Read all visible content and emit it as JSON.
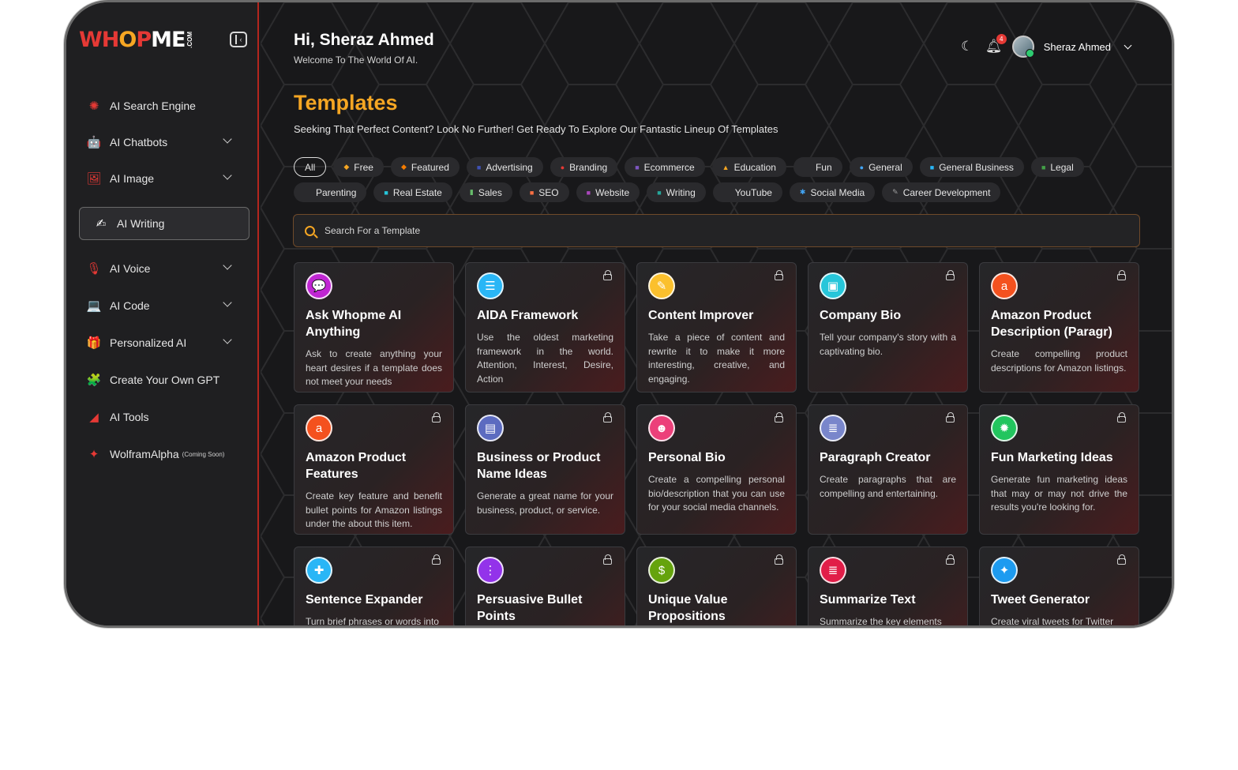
{
  "brand": {
    "logo_w": "WH",
    "logo_o": "O",
    "logo_p": "P",
    "logo_me": "ME",
    "logo_sub": ".COM"
  },
  "sidebar": {
    "items": [
      {
        "label": "AI Search Engine",
        "icon": "✺",
        "color": "#e53935"
      },
      {
        "label": "AI Chatbots",
        "icon": "🤖",
        "color": "#e53935"
      },
      {
        "label": "AI Image",
        "icon": "🖼",
        "color": "#e53935"
      },
      {
        "label": "AI Writing",
        "icon": "✍",
        "color": "#ffffff"
      },
      {
        "label": "AI Voice",
        "icon": "🎙",
        "color": "#e53935"
      },
      {
        "label": "AI Code",
        "icon": "💻",
        "color": "#e53935"
      },
      {
        "label": "Personalized AI",
        "icon": "🎁",
        "color": "#e53935"
      },
      {
        "label": "Create Your Own GPT",
        "icon": "🧩",
        "color": "#e53935"
      },
      {
        "label": "AI Tools",
        "icon": "◢",
        "color": "#e53935"
      },
      {
        "label": "WolframAlpha",
        "suffix": "(Coming Soon)",
        "icon": "✦",
        "color": "#e53935"
      }
    ]
  },
  "header": {
    "greeting": "Hi, Sheraz Ahmed",
    "welcome": "Welcome To The World Of AI.",
    "notif_count": "4",
    "user_name": "Sheraz Ahmed"
  },
  "page": {
    "title": "Templates",
    "subtitle": "Seeking That Perfect Content? Look No Further! Get Ready To Explore Our Fantastic Lineup Of Templates"
  },
  "filters": {
    "row1": [
      {
        "label": "All",
        "icon": "",
        "active": true
      },
      {
        "label": "Free",
        "icon": "◆",
        "color": "#f5a623"
      },
      {
        "label": "Featured",
        "icon": "◆",
        "color": "#f57c00"
      },
      {
        "label": "Advertising",
        "icon": "■",
        "color": "#3f51b5"
      },
      {
        "label": "Branding",
        "icon": "●",
        "color": "#e53935"
      },
      {
        "label": "Ecommerce",
        "icon": "■",
        "color": "#7e57c2"
      },
      {
        "label": "Education",
        "icon": "▲",
        "color": "#f5a623"
      },
      {
        "label": "Fun",
        "icon": "",
        "color": ""
      },
      {
        "label": "General",
        "icon": "●",
        "color": "#42a5f5"
      },
      {
        "label": "General Business",
        "icon": "■",
        "color": "#29b6f6"
      },
      {
        "label": "Legal",
        "icon": "■",
        "color": "#43a047"
      }
    ],
    "row2": [
      {
        "label": "Parenting",
        "icon": "",
        "color": ""
      },
      {
        "label": "Real Estate",
        "icon": "■",
        "color": "#26c6da"
      },
      {
        "label": "Sales",
        "icon": "▮",
        "color": "#66bb6a"
      },
      {
        "label": "SEO",
        "icon": "■",
        "color": "#ff7043"
      },
      {
        "label": "Website",
        "icon": "■",
        "color": "#ab47bc"
      },
      {
        "label": "Writing",
        "icon": "■",
        "color": "#26a69a"
      },
      {
        "label": "YouTube",
        "icon": "",
        "color": ""
      },
      {
        "label": "Social Media",
        "icon": "✱",
        "color": "#42a5f5"
      },
      {
        "label": "Career Development",
        "icon": "✎",
        "color": "#9e9e9e"
      }
    ]
  },
  "search": {
    "placeholder": "Search For a Template"
  },
  "cards": [
    {
      "title": "Ask Whopme AI Anything",
      "desc": "Ask to create anything your heart desires if a template does not meet your needs",
      "icon": "💬",
      "color": "#c026d3",
      "locked": false
    },
    {
      "title": "AIDA Framework",
      "desc": "Use the oldest marketing framework in the world. Attention, Interest, Desire, Action",
      "icon": "☰",
      "color": "#29b6f6",
      "locked": true
    },
    {
      "title": "Content Improver",
      "desc": "Take a piece of content and rewrite it to make it more interesting, creative, and engaging.",
      "icon": "✎",
      "color": "#fbc02d",
      "locked": true
    },
    {
      "title": "Company Bio",
      "desc": "Tell your company's story with a captivating bio.",
      "icon": "▣",
      "color": "#26c6da",
      "locked": true
    },
    {
      "title": "Amazon Product Description (Paragr)",
      "desc": "Create compelling product descriptions for Amazon listings.",
      "icon": "a",
      "color": "#f4511e",
      "locked": true
    },
    {
      "title": "Amazon Product Features",
      "desc": "Create key feature and benefit bullet points for Amazon listings under the about this item.",
      "icon": "a",
      "color": "#f4511e",
      "locked": true
    },
    {
      "title": "Business or Product Name Ideas",
      "desc": "Generate a great name for your business, product, or service.",
      "icon": "▤",
      "color": "#5c6bc0",
      "locked": true
    },
    {
      "title": "Personal Bio",
      "desc": "Create a compelling personal bio/description that you can use for your social media channels.",
      "icon": "☻",
      "color": "#ec407a",
      "locked": true
    },
    {
      "title": "Paragraph Creator",
      "desc": "Create paragraphs that are compelling and entertaining.",
      "icon": "≣",
      "color": "#7986cb",
      "locked": true
    },
    {
      "title": "Fun Marketing Ideas",
      "desc": "Generate fun marketing ideas that may or may not drive the results you're looking for.",
      "icon": "✹",
      "color": "#22c55e",
      "locked": true
    },
    {
      "title": "Sentence Expander",
      "desc": "Turn brief phrases or words into",
      "icon": "✚",
      "color": "#29b6f6",
      "locked": true
    },
    {
      "title": "Persuasive Bullet Points",
      "desc": "",
      "icon": "⋮",
      "color": "#9333ea",
      "locked": true
    },
    {
      "title": "Unique Value Propositions",
      "desc": "",
      "icon": "$",
      "color": "#65a30d",
      "locked": true
    },
    {
      "title": "Summarize Text",
      "desc": "Summarize the key elements",
      "icon": "≣",
      "color": "#e11d48",
      "locked": true
    },
    {
      "title": "Tweet Generator",
      "desc": "Create viral tweets for Twitter",
      "icon": "✦",
      "color": "#1d9bf0",
      "locked": true
    }
  ]
}
